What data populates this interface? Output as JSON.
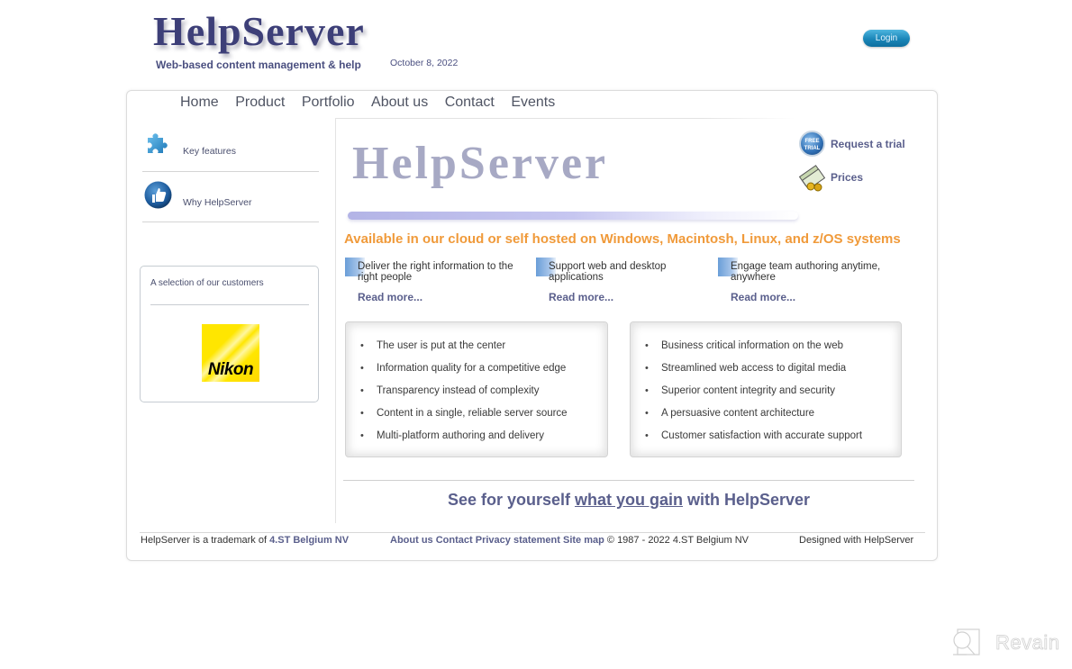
{
  "header": {
    "logo": "HelpServer",
    "tagline": "Web-based content management & help",
    "date": "October 8, 2022",
    "login_label": "Login"
  },
  "nav": {
    "items": [
      {
        "label": "Home"
      },
      {
        "label": "Product"
      },
      {
        "label": "Portfolio"
      },
      {
        "label": "About us"
      },
      {
        "label": "Contact"
      },
      {
        "label": "Events"
      }
    ]
  },
  "sidebar": {
    "items": [
      {
        "label": "Key features",
        "icon": "puzzle-icon"
      },
      {
        "label": "Why HelpServer",
        "icon": "thumbs-up-icon"
      }
    ],
    "customers": {
      "title": "A selection of our customers",
      "logo_text": "Nikon"
    }
  },
  "main": {
    "banner_logo": "HelpServer",
    "quick_links": [
      {
        "label": "Request a trial",
        "icon": "free-trial-icon"
      },
      {
        "label": "Prices",
        "icon": "money-icon"
      }
    ],
    "headline": "Available in our cloud or self hosted on Windows, Macintosh, Linux, and z/OS systems",
    "features": [
      {
        "text": "Deliver the right information to the right people",
        "link": "Read more..."
      },
      {
        "text": "Support web and desktop applications",
        "link": "Read more..."
      },
      {
        "text": "Engage team authoring anytime, anywhere",
        "link": "Read more..."
      }
    ],
    "benefits_left": [
      "The user is put at the center",
      "Information quality for a competitive edge",
      "Transparency instead of complexity",
      "Content in a single, reliable server source",
      "Multi-platform authoring and delivery"
    ],
    "benefits_right": [
      "Business critical information on the web",
      "Streamlined web access to digital media",
      "Superior content integrity and security",
      "A persuasive content architecture",
      "Customer satisfaction with accurate support"
    ],
    "cta": {
      "before": "See for yourself ",
      "link": "what you gain",
      "after": " with HelpServer"
    }
  },
  "footer": {
    "trademark_prefix": "HelpServer is a trademark of ",
    "trademark_company": "4.ST Belgium NV",
    "links": [
      {
        "label": "About us"
      },
      {
        "label": "Contact"
      },
      {
        "label": "Privacy statement"
      },
      {
        "label": "Site map"
      }
    ],
    "copyright": "© 1987 - 2022 4.ST Belgium NV",
    "designed": "Designed with HelpServer"
  },
  "watermark": {
    "text": "Revain"
  },
  "colors": {
    "brand_navy": "#3d3f78",
    "link_purple": "#5a5f8c",
    "headline_orange": "#f09a3a",
    "login_blue": "#1a86b8"
  }
}
